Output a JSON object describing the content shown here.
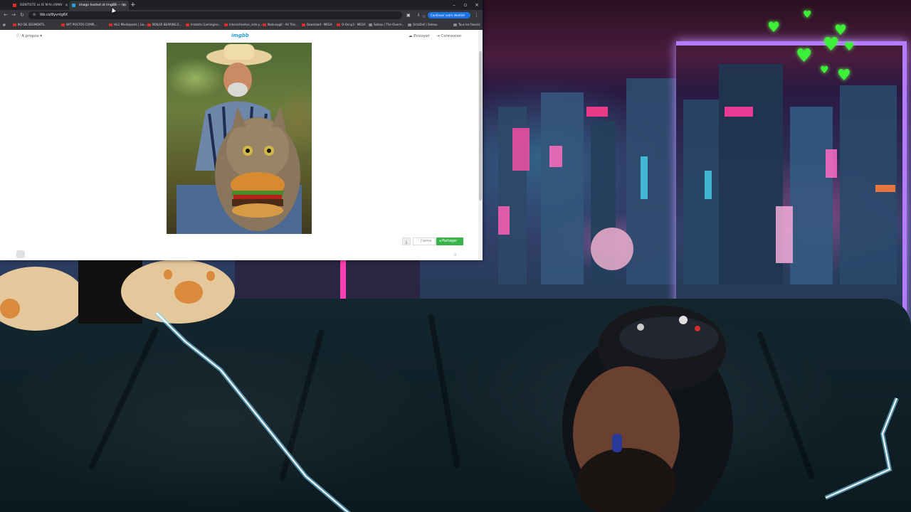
{
  "browser": {
    "tabs": [
      {
        "label": "DENTISTE vs IE N'AI (AMAI",
        "favicon_color": "#e52d27",
        "active": false
      },
      {
        "label": "image hosted at ImgBB — Im",
        "favicon_color": "#2a9fd6",
        "active": true
      }
    ],
    "url": "ibb.co/8yvntg6X",
    "sync_button": "Continuer votre identité",
    "bookmarks": [
      {
        "label": "IKU DE SEGMENTS...",
        "color": "#e52d27"
      },
      {
        "label": "WIT POSTOS COMPL...",
        "color": "#e52d27"
      },
      {
        "label": "HLG Mixdepants | Lia...",
        "color": "#e52d27"
      },
      {
        "label": "BOILER BEARING E...",
        "color": "#e52d27"
      },
      {
        "label": "Instants Gamingcor...",
        "color": "#e52d27"
      },
      {
        "label": "Interactivehon_sets-y...",
        "color": "#e52d27"
      },
      {
        "label": "Nubunygit - All This...",
        "color": "#e52d27"
      },
      {
        "label": "Download - MEGA",
        "color": "#e52d27"
      },
      {
        "label": "O-Ocnp3 - MEGA",
        "color": "#e52d27"
      },
      {
        "label": "Soleau | The Overm...",
        "color": "#888888"
      },
      {
        "label": "OctoDoll | Soleau",
        "color": "#888888"
      },
      {
        "label": "Tous les favoris",
        "color": "#888888"
      }
    ]
  },
  "page": {
    "about_label": "À propos",
    "logo": "imgbb",
    "upload_label": "Envoyer",
    "login_label": "Connexion",
    "like_label": "J'aime",
    "share_label": "Partager",
    "views_count": "0"
  },
  "colors": {
    "share_green": "#38b44a",
    "imgbb_blue": "#2a9fd6",
    "neon_purple": "#b57bff",
    "heart_green": "#3cf03a"
  }
}
